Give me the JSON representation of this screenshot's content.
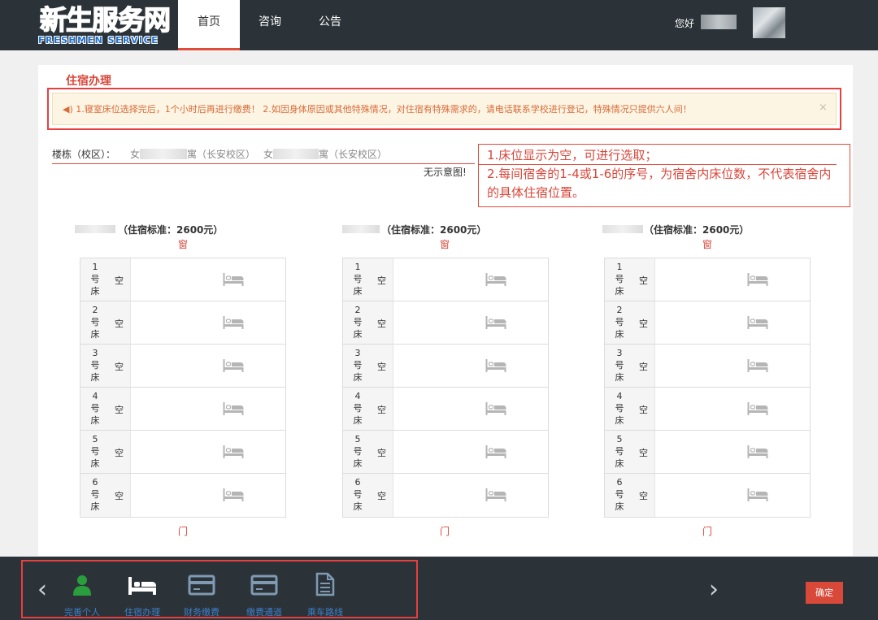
{
  "header": {
    "logo_main_blue": "新生服",
    "logo_main_red": "务",
    "logo_main_blue2": "网",
    "logo_sub": "FRESHMEN SERVICE",
    "tabs": [
      {
        "label": "首页",
        "active": true
      },
      {
        "label": "咨询",
        "active": false
      },
      {
        "label": "公告",
        "active": false
      }
    ],
    "greeting": "您好"
  },
  "page": {
    "title": "住宿办理",
    "notice": "◀) 1.寝室床位选择完后，1个小时后再进行缴费！ 2.如因身体原因或其他特殊情况，对住宿有特殊需求的，请电话联系学校进行登记，特殊情况只提供六人间！",
    "notice_close": "×",
    "building_label": "楼栋（校区）：",
    "building_options": [
      {
        "prefix": "女",
        "suffix": "寓（长安校区）"
      },
      {
        "prefix": "女",
        "suffix": "寓（长安校区）"
      }
    ],
    "no_image": "无示意图!",
    "callout_line1": "1.床位显示为空，可进行选取；",
    "callout_line2": "2.每间宿舍的1-4或1-6的序号，为宿舍内床位数，不代表宿舍内的具体住宿位置。"
  },
  "rooms": [
    {
      "standard": "（住宿标准：2600元）",
      "window": "窗",
      "door": "门",
      "beds": [
        {
          "num": "1",
          "unit": "号",
          "tail": "床",
          "status": "空"
        },
        {
          "num": "2",
          "unit": "号",
          "tail": "床",
          "status": "空"
        },
        {
          "num": "3",
          "unit": "号",
          "tail": "床",
          "status": "空"
        },
        {
          "num": "4",
          "unit": "号",
          "tail": "床",
          "status": "空"
        },
        {
          "num": "5",
          "unit": "号",
          "tail": "床",
          "status": "空"
        },
        {
          "num": "6",
          "unit": "号",
          "tail": "床",
          "status": "空"
        }
      ]
    },
    {
      "standard": "（住宿标准：2600元）",
      "window": "窗",
      "door": "门",
      "beds": [
        {
          "num": "1",
          "unit": "号",
          "tail": "床",
          "status": "空"
        },
        {
          "num": "2",
          "unit": "号",
          "tail": "床",
          "status": "空"
        },
        {
          "num": "3",
          "unit": "号",
          "tail": "床",
          "status": "空"
        },
        {
          "num": "4",
          "unit": "号",
          "tail": "床",
          "status": "空"
        },
        {
          "num": "5",
          "unit": "号",
          "tail": "床",
          "status": "空"
        },
        {
          "num": "6",
          "unit": "号",
          "tail": "床",
          "status": "空"
        }
      ]
    },
    {
      "standard": "（住宿标准：2600元）",
      "window": "窗",
      "door": "门",
      "beds": [
        {
          "num": "1",
          "unit": "号",
          "tail": "床",
          "status": "空"
        },
        {
          "num": "2",
          "unit": "号",
          "tail": "床",
          "status": "空"
        },
        {
          "num": "3",
          "unit": "号",
          "tail": "床",
          "status": "空"
        },
        {
          "num": "4",
          "unit": "号",
          "tail": "床",
          "status": "空"
        },
        {
          "num": "5",
          "unit": "号",
          "tail": "床",
          "status": "空"
        },
        {
          "num": "6",
          "unit": "号",
          "tail": "床",
          "status": "空"
        }
      ]
    }
  ],
  "footer": {
    "prev_arrow": "‹",
    "next_arrow": "›",
    "menu": [
      {
        "label": "完善个人",
        "icon": "person-icon"
      },
      {
        "label": "住宿办理",
        "icon": "bed-icon"
      },
      {
        "label": "财务缴费",
        "icon": "card-icon"
      },
      {
        "label": "缴费通道",
        "icon": "card-icon"
      },
      {
        "label": "乘车路线",
        "icon": "document-icon"
      }
    ],
    "confirm": "确定"
  },
  "colors": {
    "header_bg": "#2b3338",
    "accent_red": "#d9463a",
    "link_blue": "#3d7fc9",
    "person_green": "#2a9d3c"
  }
}
